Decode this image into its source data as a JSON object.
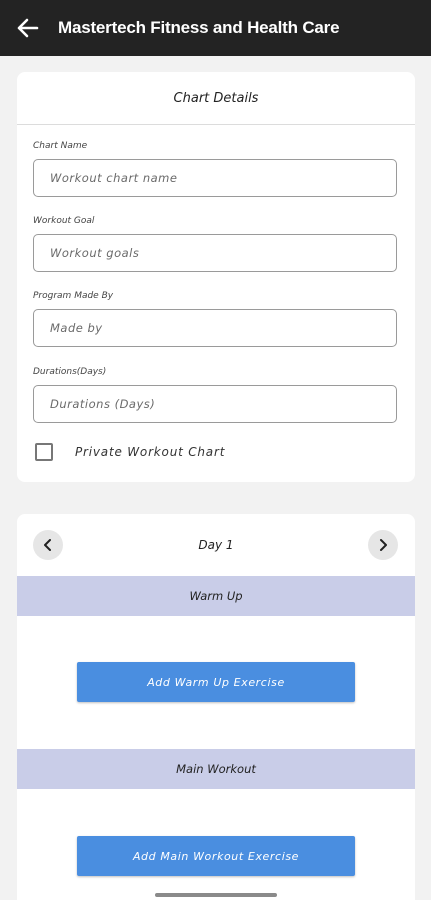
{
  "appbar": {
    "title": "Mastertech Fitness and Health Care"
  },
  "chart_details": {
    "header": "Chart Details",
    "fields": [
      {
        "label": "Chart Name",
        "placeholder": "Workout chart name"
      },
      {
        "label": "Workout Goal",
        "placeholder": "Workout goals"
      },
      {
        "label": "Program Made By",
        "placeholder": "Made by"
      },
      {
        "label": "Durations(Days)",
        "placeholder": "Durations (Days)"
      }
    ],
    "private_checkbox": {
      "label": "Private Workout Chart",
      "checked": false
    }
  },
  "day_panel": {
    "day_label": "Day 1",
    "sections": [
      {
        "title": "Warm Up",
        "button_label": "Add Warm Up Exercise"
      },
      {
        "title": "Main Workout",
        "button_label": "Add Main Workout Exercise"
      }
    ]
  },
  "colors": {
    "appbar": "#232323",
    "section_band": "#c9cde8",
    "action_button": "#4a8ee0"
  }
}
